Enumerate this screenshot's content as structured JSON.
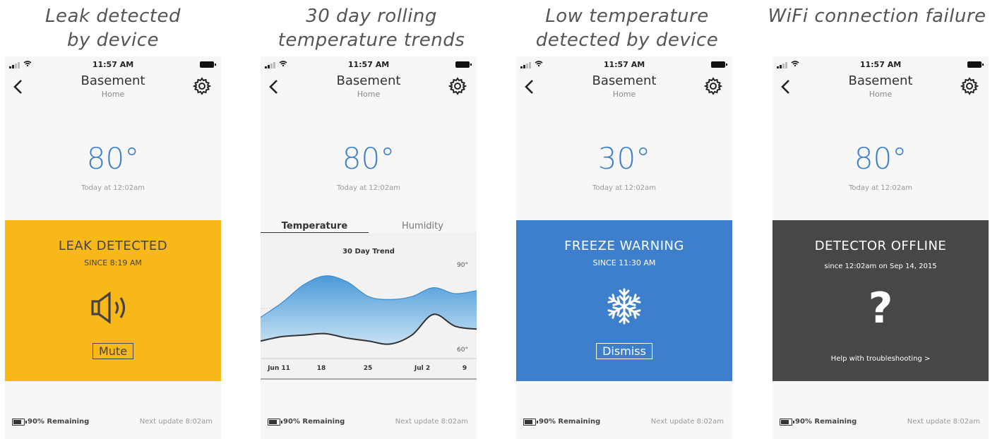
{
  "captions": [
    "Leak detected\nby device",
    "30 day rolling\ntemperature trends",
    "Low temperature\ndetected by device",
    "WiFi connection failure"
  ],
  "status_bar": {
    "time": "11:57 AM"
  },
  "header": {
    "title": "Basement",
    "subtitle": "Home"
  },
  "footer": {
    "battery": "90% Remaining",
    "next_update": "Next update 8:02am"
  },
  "screens": [
    {
      "temperature": "80°",
      "timestamp": "Today at 12:02am",
      "alert": {
        "title": "LEAK DETECTED",
        "subtitle": "SINCE 8:19 AM",
        "icon": "speaker-icon",
        "button": "Mute",
        "background": "#f8b81a",
        "text_color": "#444444"
      }
    },
    {
      "temperature": "80°",
      "timestamp": "Today at 12:02am",
      "tabs": [
        "Temperature",
        "Humidity"
      ],
      "active_tab": "Temperature"
    },
    {
      "temperature": "30°",
      "timestamp": "Today at 12:02am",
      "alert": {
        "title": "FREEZE WARNING",
        "subtitle": "SINCE 11:30 AM",
        "icon": "snowflake-icon",
        "button": "Dismiss",
        "background": "#3d7fcc",
        "text_color": "#ffffff"
      }
    },
    {
      "temperature": "80°",
      "timestamp": "Today at 12:02am",
      "alert": {
        "title": "DETECTOR OFFLINE",
        "subtitle": "since 12:02am on Sep 14, 2015",
        "icon": "question-icon",
        "link": "Help with troubleshooting >",
        "background": "#474747",
        "text_color": "#ffffff"
      }
    }
  ],
  "chart_data": {
    "type": "area",
    "title": "30 Day Trend",
    "x_ticks": [
      "Jun 11",
      "18",
      "25",
      "Jul 2",
      "9"
    ],
    "y_ticks": [
      "90°",
      "60°"
    ],
    "ylim": [
      60,
      90
    ],
    "series": [
      {
        "values": [
          72,
          77,
          83,
          86,
          84,
          79,
          78,
          79,
          82,
          80,
          81
        ],
        "color": "#5aa6dc"
      },
      {
        "values": [
          64,
          65.5,
          66,
          66.5,
          65,
          64,
          63,
          66,
          73,
          69,
          68
        ],
        "color": "#333333"
      }
    ],
    "colors": {
      "fill_top": "#4a9ad8",
      "fill_bottom": "#cfe6f6",
      "line": "#333333"
    }
  }
}
